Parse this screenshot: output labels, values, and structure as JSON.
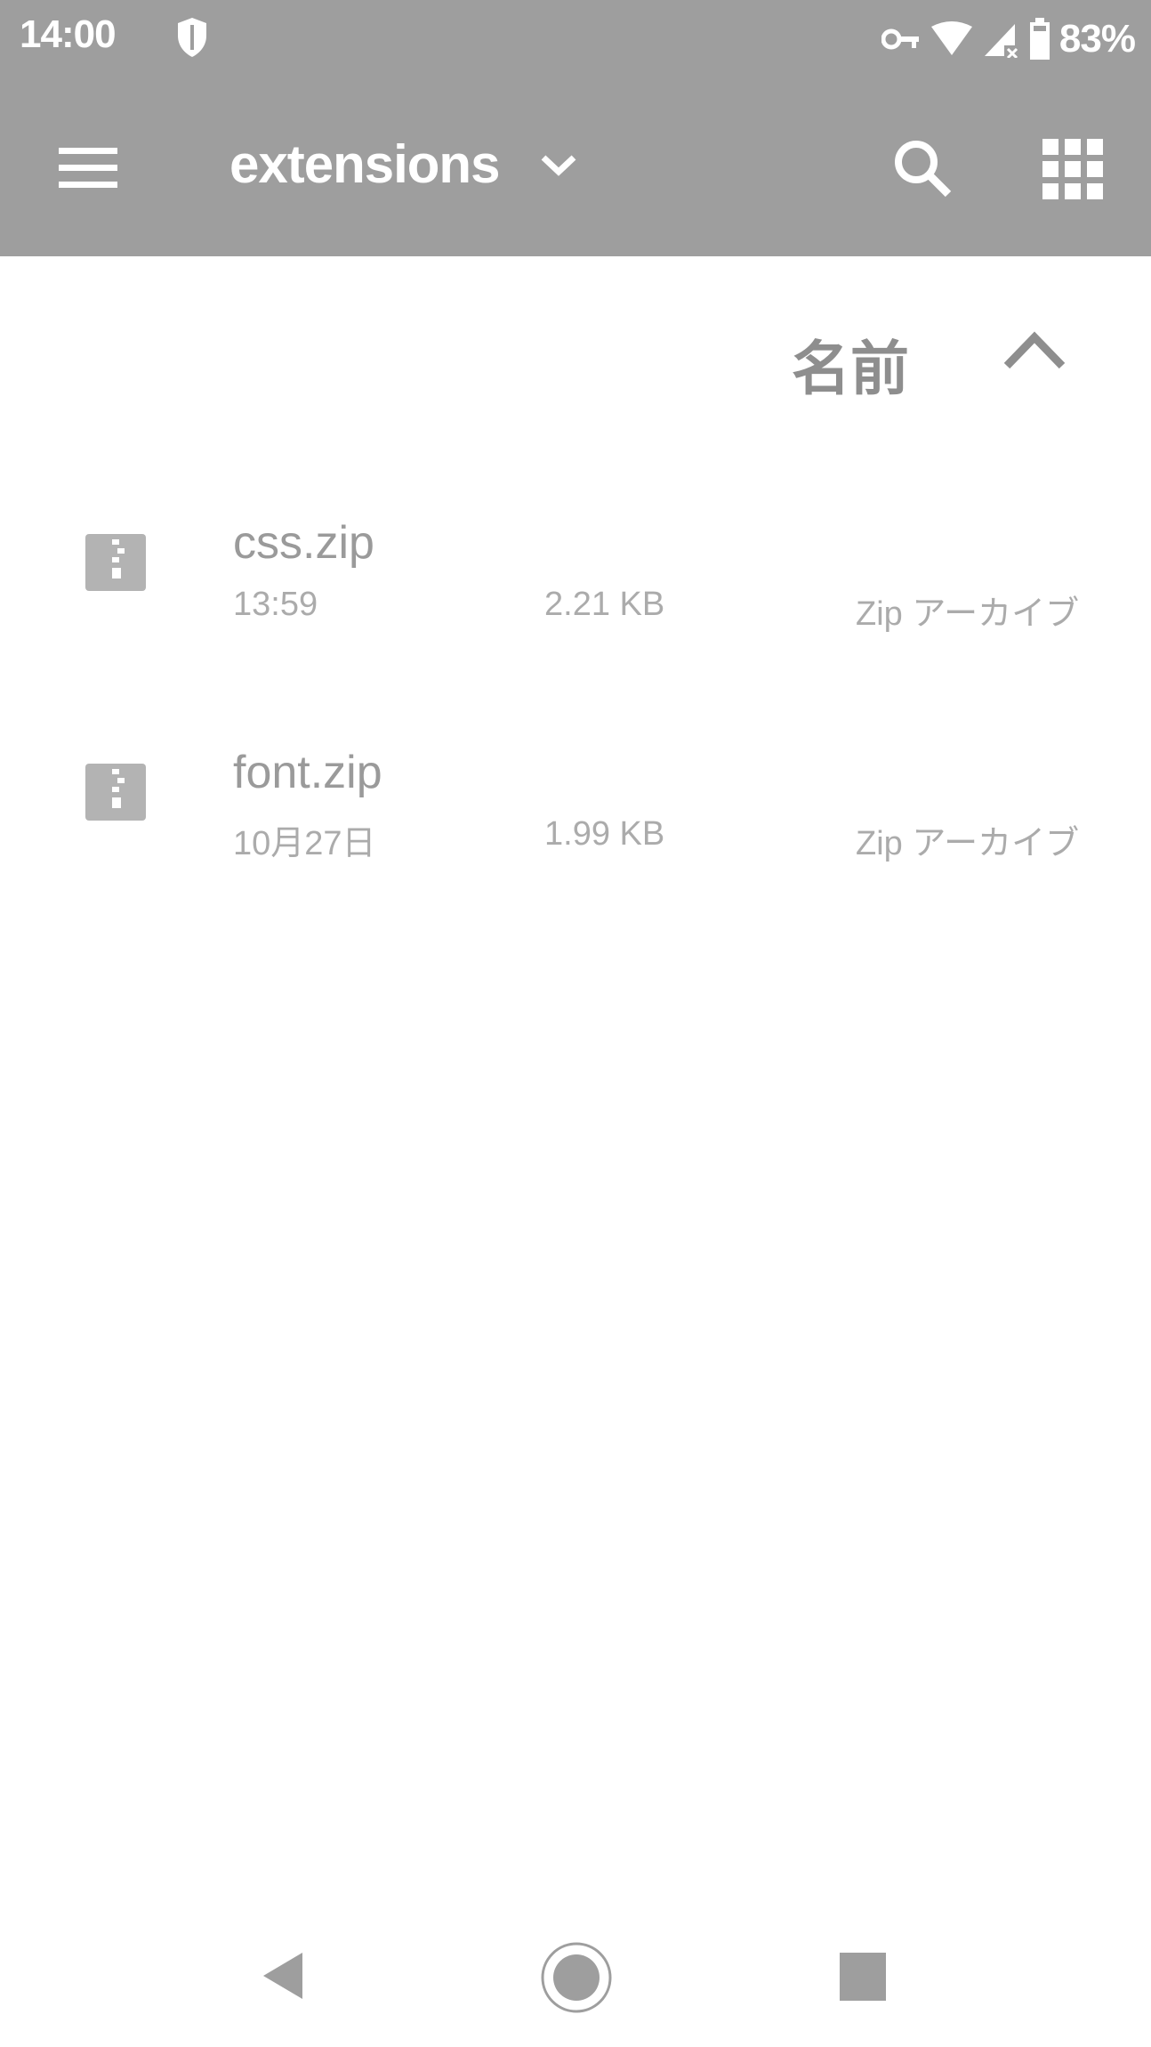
{
  "status_bar": {
    "time": "14:00",
    "battery_text": "83%",
    "icons": [
      "shield-icon",
      "vpn-key-icon",
      "wifi-icon",
      "cell-signal-icon",
      "battery-icon"
    ]
  },
  "app_bar": {
    "title": "extensions",
    "icons": [
      "menu-icon",
      "chevron-down-icon",
      "search-icon",
      "grid-view-icon"
    ]
  },
  "sort": {
    "label": "名前",
    "direction_icon": "chevron-up-icon"
  },
  "files": [
    {
      "name": "css.zip",
      "date": "13:59",
      "size": "2.21 KB",
      "type": "Zip アーカイブ",
      "icon": "zip-file-icon"
    },
    {
      "name": "font.zip",
      "date": "10月27日",
      "size": "1.99 KB",
      "type": "Zip アーカイブ",
      "icon": "zip-file-icon"
    }
  ],
  "nav_bar": {
    "icons": [
      "back-icon",
      "home-icon",
      "recents-icon"
    ]
  },
  "colors": {
    "app_bar": "#9e9e9e",
    "primary_text": "#9a9a9a",
    "secondary_text": "#ababab",
    "background": "#ffffff"
  }
}
